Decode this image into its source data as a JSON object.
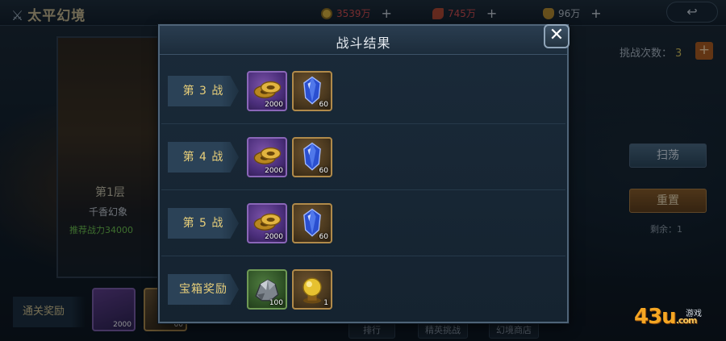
{
  "topbar": {
    "title": "太平幻境",
    "resources": [
      {
        "icon": "gold-coin-icon",
        "value": "3539万"
      },
      {
        "icon": "feather-icon",
        "value": "745万"
      },
      {
        "icon": "wings-icon",
        "value": "96万"
      }
    ]
  },
  "floor": {
    "name": "第1层",
    "subtitle": "千香幻象",
    "power": "推荐战力34000"
  },
  "clear_rewards": {
    "label": "通关奖励",
    "items": [
      {
        "icon": "gold-coin-icon",
        "count": "2000"
      },
      {
        "icon": "crystal-icon",
        "count": "60"
      }
    ]
  },
  "right_panel": {
    "attempts_label": "挑战次数：",
    "attempts_value": "3",
    "add_label": "+",
    "sweep_label": "扫荡",
    "reset_label": "重置",
    "remaining_label": "剩余：",
    "remaining_value": "1"
  },
  "bottom_tabs": [
    "排行",
    "精英挑战",
    "幻境商店"
  ],
  "watermark": {
    "brand": "43u",
    "domain": ".com",
    "tag": "游戏"
  },
  "modal": {
    "title": "战斗结果",
    "close_label": "✕",
    "rows": [
      {
        "label": "第 3 战",
        "items": [
          {
            "type": "coins",
            "name": "gold-coin-icon",
            "count": "2000"
          },
          {
            "type": "crystal",
            "name": "blue-crystal-icon",
            "count": "60"
          }
        ]
      },
      {
        "label": "第 4 战",
        "items": [
          {
            "type": "coins",
            "name": "gold-coin-icon",
            "count": "2000"
          },
          {
            "type": "crystal",
            "name": "blue-crystal-icon",
            "count": "60"
          }
        ]
      },
      {
        "label": "第 5 战",
        "items": [
          {
            "type": "coins",
            "name": "gold-coin-icon",
            "count": "2000"
          },
          {
            "type": "crystal",
            "name": "blue-crystal-icon",
            "count": "60"
          }
        ]
      },
      {
        "label": "宝箱奖励",
        "items": [
          {
            "type": "ore",
            "name": "iron-ore-icon",
            "count": "100"
          },
          {
            "type": "orb",
            "name": "golden-orb-icon",
            "count": "1"
          }
        ]
      }
    ]
  }
}
